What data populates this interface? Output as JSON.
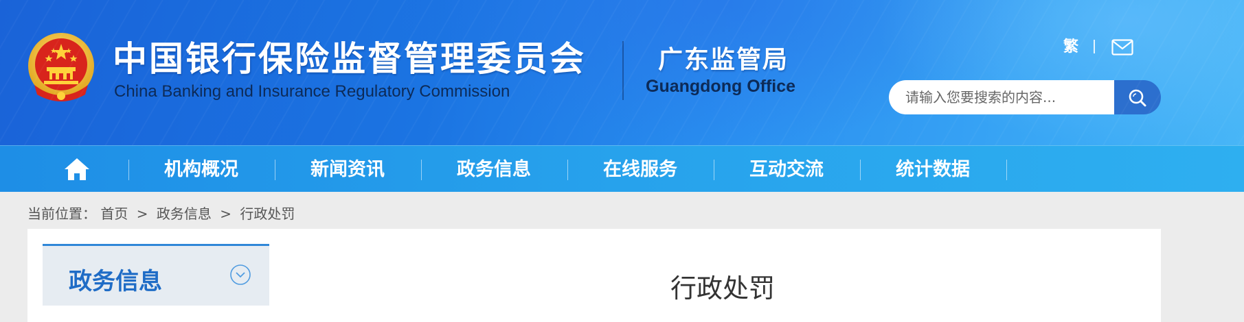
{
  "header": {
    "title_cn": "中国银行保险监督管理委员会",
    "title_en": "China Banking and Insurance Regulatory Commission",
    "office_cn": "广东监管局",
    "office_en": "Guangdong Office",
    "traditional_label": "繁",
    "mail_icon": "mail-icon",
    "search": {
      "placeholder": "请输入您要搜索的内容...",
      "value": "",
      "button_icon": "search-icon"
    }
  },
  "nav": {
    "home_icon": "home-icon",
    "items": [
      {
        "label": "机构概况"
      },
      {
        "label": "新闻资讯"
      },
      {
        "label": "政务信息"
      },
      {
        "label": "在线服务"
      },
      {
        "label": "互动交流"
      },
      {
        "label": "统计数据"
      }
    ]
  },
  "breadcrumb": {
    "prefix": "当前位置：",
    "items": [
      "首页",
      "政务信息",
      "行政处罚"
    ],
    "separator": ">"
  },
  "sidebar": {
    "title": "政务信息",
    "toggle_icon": "chevron-down-circle-icon"
  },
  "main": {
    "title": "行政处罚"
  },
  "colors": {
    "header_blue": "#1b74e2",
    "nav_blue": "#27a2ec",
    "accent_blue": "#1f6cc6",
    "search_button": "#2c6fce",
    "page_bg": "#ececec"
  }
}
